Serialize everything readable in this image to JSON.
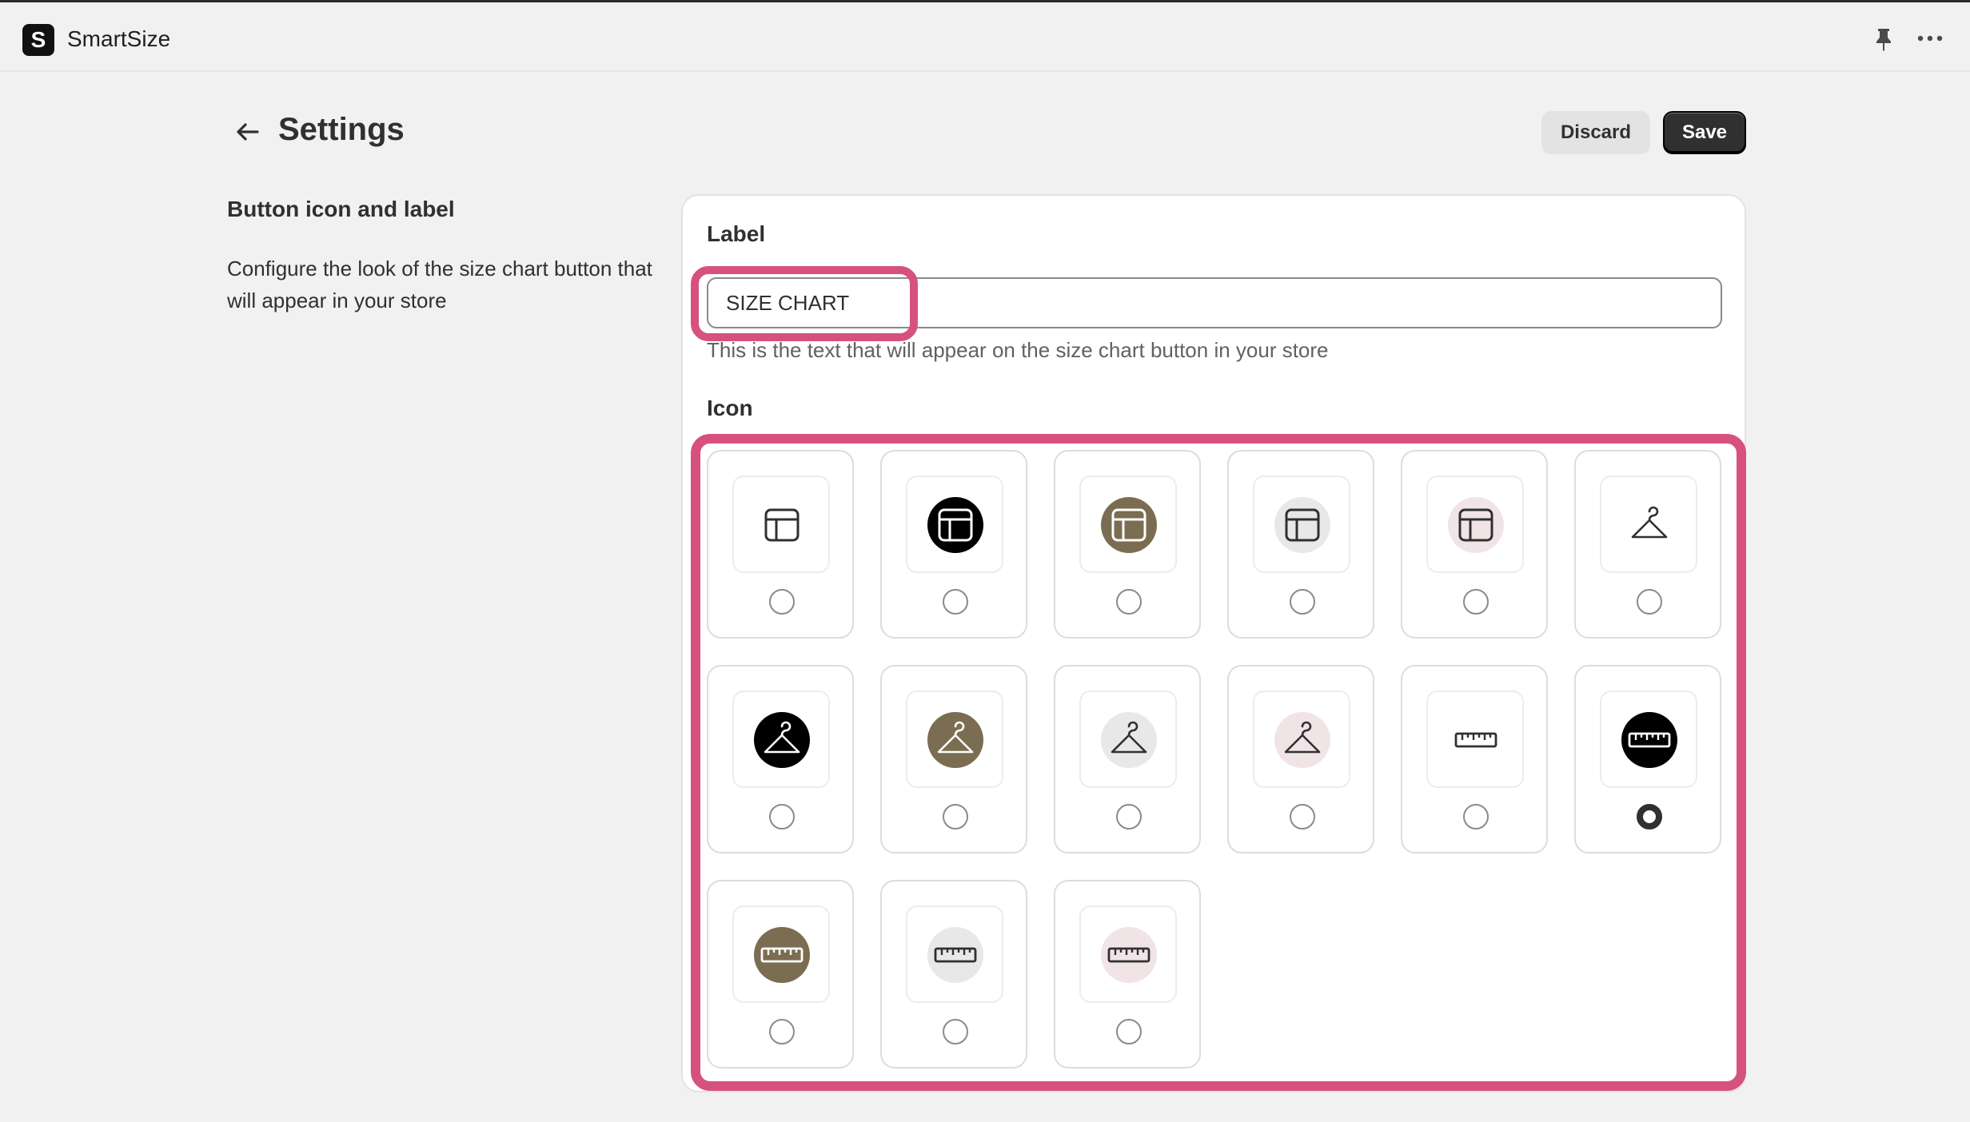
{
  "app": {
    "name": "SmartSize",
    "logo_letter": "S"
  },
  "header": {
    "title": "Settings",
    "discard_label": "Discard",
    "save_label": "Save"
  },
  "section": {
    "title": "Button icon and label",
    "description": "Configure the look of the size chart button that will appear in your store"
  },
  "label_field": {
    "label": "Label",
    "value": "SIZE CHART",
    "help": "This is the text that will appear on the size chart button in your store"
  },
  "icon_field": {
    "label": "Icon"
  },
  "icons": [
    {
      "name": "table-outline-icon",
      "glyph": "table",
      "bg": "none",
      "selected": false
    },
    {
      "name": "table-black-icon",
      "glyph": "table",
      "bg": "#000000",
      "selected": false
    },
    {
      "name": "table-olive-icon",
      "glyph": "table",
      "bg": "#7b6d51",
      "selected": false
    },
    {
      "name": "table-grey-icon",
      "glyph": "table",
      "bg": "#e8e8e8",
      "selected": false
    },
    {
      "name": "table-pink-icon",
      "glyph": "table",
      "bg": "#f1e4e6",
      "selected": false
    },
    {
      "name": "hanger-outline-icon",
      "glyph": "hanger",
      "bg": "none",
      "selected": false
    },
    {
      "name": "hanger-black-icon",
      "glyph": "hanger",
      "bg": "#000000",
      "selected": false
    },
    {
      "name": "hanger-olive-icon",
      "glyph": "hanger",
      "bg": "#7b6d51",
      "selected": false
    },
    {
      "name": "hanger-grey-icon",
      "glyph": "hanger",
      "bg": "#e8e8e8",
      "selected": false
    },
    {
      "name": "hanger-pink-icon",
      "glyph": "hanger",
      "bg": "#f1e4e6",
      "selected": false
    },
    {
      "name": "ruler-outline-icon",
      "glyph": "ruler",
      "bg": "none",
      "selected": false
    },
    {
      "name": "ruler-black-icon",
      "glyph": "ruler",
      "bg": "#000000",
      "selected": true
    },
    {
      "name": "ruler-olive-icon",
      "glyph": "ruler",
      "bg": "#7b6d51",
      "selected": false
    },
    {
      "name": "ruler-grey-icon",
      "glyph": "ruler",
      "bg": "#e8e8e8",
      "selected": false
    },
    {
      "name": "ruler-pink-icon",
      "glyph": "ruler",
      "bg": "#f1e4e6",
      "selected": false
    }
  ],
  "colors": {
    "highlight": "#d6517f",
    "primary": "#303030"
  }
}
